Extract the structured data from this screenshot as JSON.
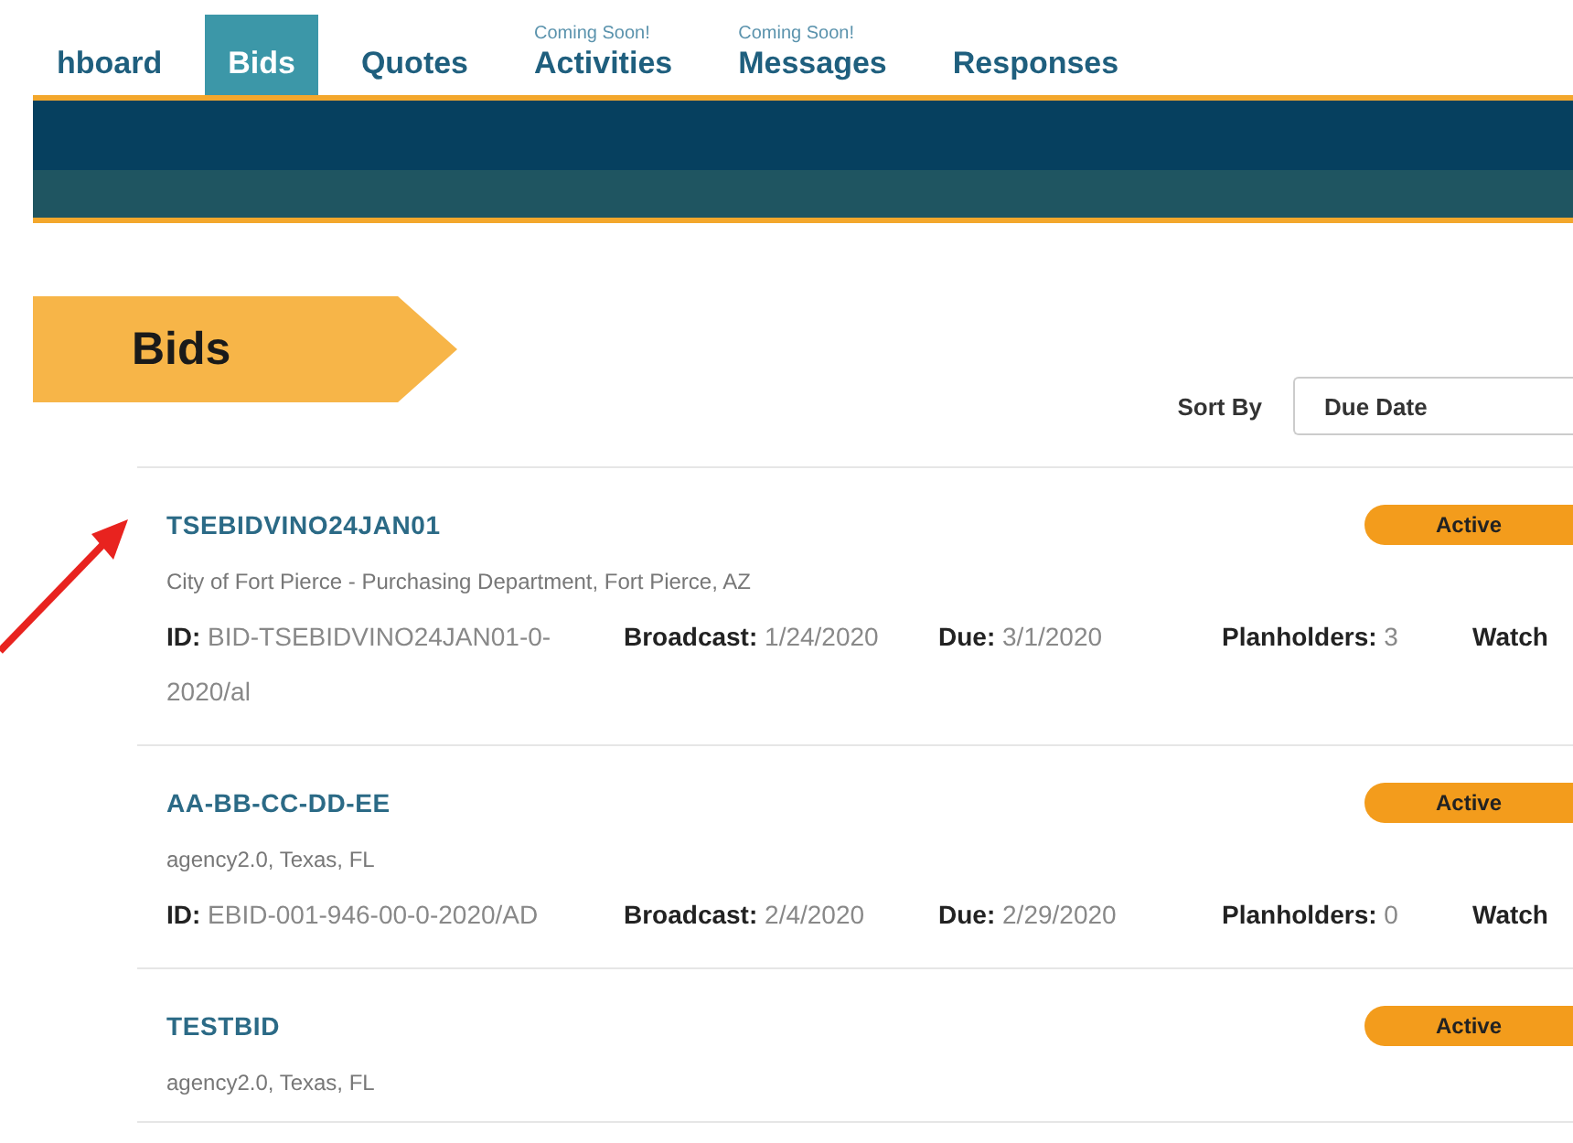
{
  "nav": {
    "tabs": [
      {
        "label": "hboard",
        "selected": false
      },
      {
        "label": "Bids",
        "selected": true
      },
      {
        "label": "Quotes",
        "selected": false
      },
      {
        "label": "Activities",
        "note": "Coming Soon!",
        "selected": false
      },
      {
        "label": "Messages",
        "note": "Coming Soon!",
        "selected": false
      },
      {
        "label": "Responses",
        "selected": false
      }
    ]
  },
  "page_title": "Bids",
  "sort": {
    "label": "Sort By",
    "value": "Due Date"
  },
  "bids": [
    {
      "title": "TSEBIDVINO24JAN01",
      "status": "Active",
      "agency": "City of Fort Pierce - Purchasing Department, Fort Pierce, AZ",
      "meta": [
        "**ID:** BID-TSEBIDVINO24JAN01-0-2020/al",
        "**Broadcast:** 1/24/2020",
        "**Due:** 3/1/2020",
        "**Planholders:** 3",
        "**Watch**"
      ]
    },
    {
      "title": "AA-BB-CC-DD-EE",
      "status": "Active",
      "agency": "agency2.0, Texas, FL",
      "meta": [
        "**ID:** EBID-001-946-00-0-2020/AD",
        "**Broadcast:** 2/4/2020",
        "**Due:** 2/29/2020",
        "**Planholders:** 0",
        "**Watch**"
      ]
    },
    {
      "title": "TESTBID",
      "status": "Active",
      "agency": "agency2.0, Texas, FL"
    }
  ]
}
